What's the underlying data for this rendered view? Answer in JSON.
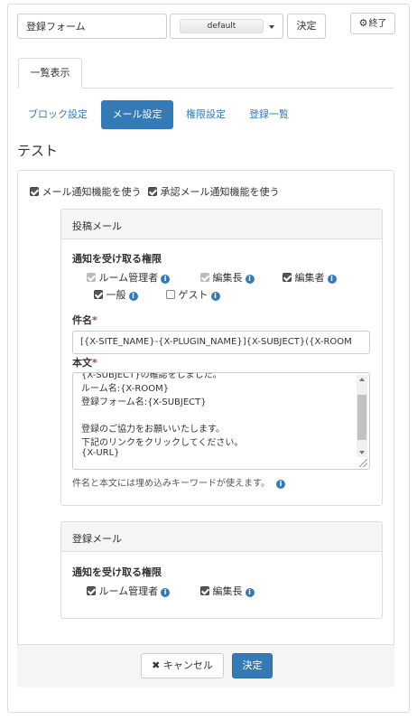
{
  "top_bar": {
    "frame_name_value": "登録フォーム",
    "select_value": "default",
    "ok_label": "決定",
    "end_label": "終了"
  },
  "tabs": {
    "list_label": "一覧表示"
  },
  "nav_pills": [
    {
      "label": "ブロック設定",
      "active": false
    },
    {
      "label": "メール設定",
      "active": true
    },
    {
      "label": "権限設定",
      "active": false
    },
    {
      "label": "登録一覧",
      "active": false
    }
  ],
  "frame_title": "テスト",
  "options": {
    "mail_notify_label": "メール通知機能を使う",
    "mail_notify_checked": true,
    "approval_notify_label": "承認メール通知機能を使う",
    "approval_notify_checked": true
  },
  "post_mail": {
    "heading": "投稿メール",
    "permission_label": "通知を受け取る権限",
    "roles": [
      {
        "label": "ルーム管理者",
        "checked": true,
        "disabled": true
      },
      {
        "label": "編集長",
        "checked": true,
        "disabled": true
      },
      {
        "label": "編集者",
        "checked": true,
        "disabled": false
      },
      {
        "label": "一般",
        "checked": true,
        "disabled": false
      },
      {
        "label": "ゲスト",
        "checked": false,
        "disabled": false
      }
    ],
    "subject_label": "件名",
    "required_mark": "*",
    "subject_value": "[{X-SITE_NAME}-{X-PLUGIN_NAME}]{X-SUBJECT}({X-ROOM",
    "body_label": "本文",
    "body_lines": [
      "{X-SUBJECT}の確認をしました。",
      "ルーム名:{X-ROOM}",
      "登録フォーム名:{X-SUBJECT}",
      "",
      "登録のご協力をお願いいたします。",
      "下記のリンクをクリックしてください。",
      "{X-URL}"
    ],
    "hint": "件名と本文には埋め込みキーワードが使えます。"
  },
  "register_mail": {
    "heading": "登録メール",
    "permission_label": "通知を受け取る権限",
    "roles": [
      {
        "label": "ルーム管理者",
        "checked": true
      },
      {
        "label": "編集長",
        "checked": true
      }
    ]
  },
  "footer": {
    "cancel_label": "キャンセル",
    "ok_label": "決定"
  },
  "colors": {
    "primary": "#337ab7",
    "required": "#a94442"
  },
  "icons": {
    "gear": "gear-icon",
    "info": "info-circle-icon",
    "close": "close-icon"
  }
}
